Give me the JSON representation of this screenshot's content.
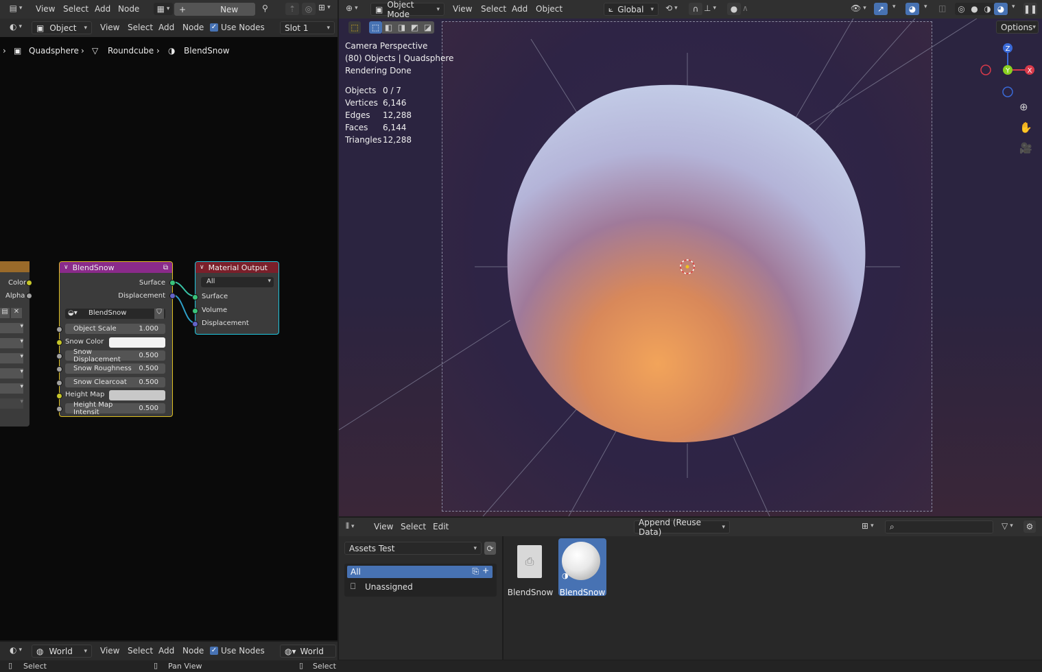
{
  "node_editor": {
    "header_menus": [
      "View",
      "Select",
      "Add",
      "Node"
    ],
    "new_label": "New",
    "row2_menus": [
      "View",
      "Select",
      "Add",
      "Node"
    ],
    "object_dropdown": "Object",
    "use_nodes_label": "Use Nodes",
    "slot_dropdown": "Slot 1",
    "breadcrumb": [
      "Quadsphere",
      "Roundcube",
      "BlendSnow"
    ],
    "left_node": {
      "outputs": [
        "Color",
        "Alpha"
      ]
    },
    "blendsnow_node": {
      "title": "BlendSnow",
      "outputs": [
        "Surface",
        "Displacement"
      ],
      "group_name": "BlendSnow",
      "fields": [
        {
          "label": "Object Scale",
          "value": "1.000"
        },
        {
          "label": "Snow Color",
          "value": ""
        },
        {
          "label": "Snow Displacement",
          "value": "0.500"
        },
        {
          "label": "Snow Roughness",
          "value": "0.500"
        },
        {
          "label": "Snow Clearcoat",
          "value": "0.500"
        },
        {
          "label": "Height Map",
          "value": ""
        },
        {
          "label": "Height Map Intensit",
          "value": "0.500"
        }
      ],
      "color": "#8a2a8a"
    },
    "material_output": {
      "title": "Material Output",
      "target": "All",
      "inputs": [
        "Surface",
        "Volume",
        "Displacement"
      ],
      "color": "#7a1f2a"
    },
    "world_dropdown": "World",
    "world_menus": [
      "View",
      "Select",
      "Add",
      "Node"
    ],
    "world_use_nodes": "Use Nodes",
    "world_slot": "World"
  },
  "viewport": {
    "mode": "Object Mode",
    "menus": [
      "View",
      "Select",
      "Add",
      "Object"
    ],
    "transform": "Global",
    "options_label": "Options",
    "overlay": [
      "Camera Perspective",
      "(80) Objects | Quadsphere",
      "Rendering Done"
    ],
    "stats": [
      {
        "label": "Objects",
        "value": "0 / 7"
      },
      {
        "label": "Vertices",
        "value": "6,146"
      },
      {
        "label": "Edges",
        "value": "12,288"
      },
      {
        "label": "Faces",
        "value": "6,144"
      },
      {
        "label": "Triangles",
        "value": "12,288"
      }
    ],
    "gizmo": {
      "z": "Z",
      "y": "Y",
      "x": "X"
    }
  },
  "asset_browser": {
    "menus": [
      "View",
      "Select",
      "Edit"
    ],
    "import_mode": "Append (Reuse Data)",
    "library": "Assets Test",
    "catalogs": [
      "All",
      "Unassigned"
    ],
    "assets": [
      "BlendSnow",
      "BlendSnow"
    ]
  },
  "status_bar": {
    "items": [
      "Select",
      "Pan View",
      "Select"
    ]
  }
}
